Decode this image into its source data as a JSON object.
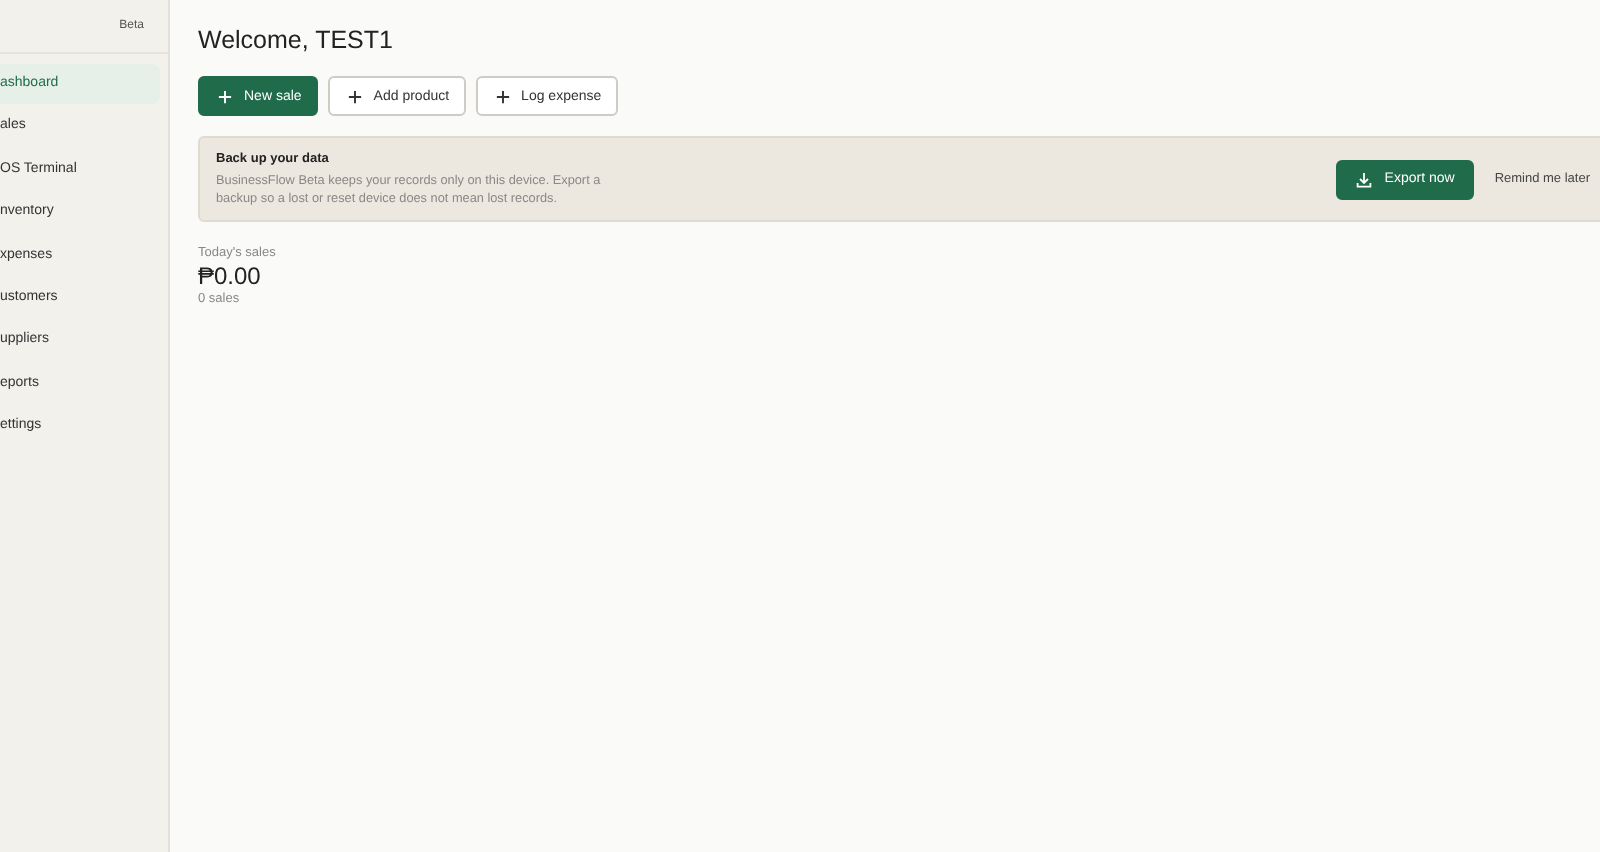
{
  "sidebar": {
    "badge": "Beta",
    "items": [
      {
        "label": "ashboard",
        "selected": true
      },
      {
        "label": "ales",
        "selected": false
      },
      {
        "label": "OS Terminal",
        "selected": false
      },
      {
        "label": "nventory",
        "selected": false
      },
      {
        "label": "xpenses",
        "selected": false
      },
      {
        "label": "ustomers",
        "selected": false
      },
      {
        "label": "uppliers",
        "selected": false
      },
      {
        "label": "eports",
        "selected": false
      },
      {
        "label": "ettings",
        "selected": false
      }
    ]
  },
  "title": "Welcome, TEST1",
  "actions": [
    {
      "label": "New sale",
      "primary": true
    },
    {
      "label": "Add product",
      "primary": false
    },
    {
      "label": "Log expense",
      "primary": false
    }
  ],
  "banner": {
    "title": "Back up your data",
    "text": "BusinessFlow Beta keeps your records only on this device. Export a backup so a lost or reset device does not mean lost records.",
    "export": "Export now",
    "remind": "Remind me later"
  },
  "stats": {
    "label": "Today's sales",
    "value": "₱0.00",
    "count": "0 sales"
  }
}
